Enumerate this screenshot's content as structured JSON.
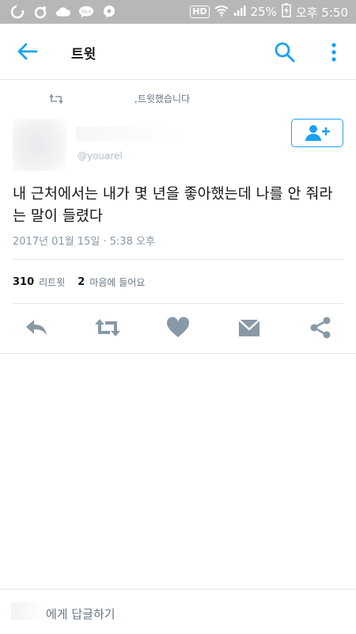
{
  "status_bar": {
    "hd_label": "HD",
    "battery": "25%",
    "time": "오후 5:50",
    "notification_badge": "TALK"
  },
  "app_bar": {
    "title": "트윗"
  },
  "retweet_banner": {
    "text": "님이 리트윗했습니다",
    "visible_text": ",트윗했습니다"
  },
  "author": {
    "handle": "@youarel"
  },
  "tweet": {
    "text": "내 근처에서는 내가 몇 년을 좋아했는데 나를 안 줘라는 말이 들렸다",
    "timestamp": "2017년 01월 15일 · 5:38 오후"
  },
  "stats": {
    "retweets_count": "310",
    "retweets_label": "리트윗",
    "likes_count": "2",
    "likes_label": "마음에 들어요"
  },
  "reply_bar": {
    "placeholder": "에게 답글하기"
  },
  "colors": {
    "accent": "#1da1f2",
    "icon_gray": "#8899a6",
    "status_bar_bg": "#b7b7b7"
  }
}
